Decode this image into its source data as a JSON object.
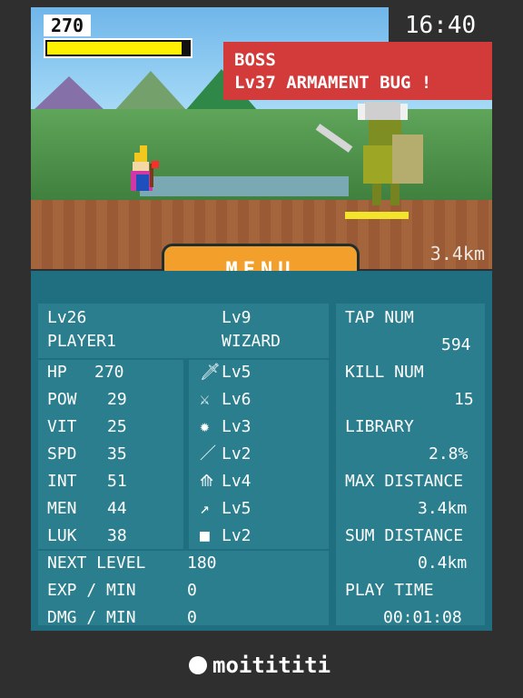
{
  "hud": {
    "player_hp": "270",
    "time": "16:40",
    "boss_title": "BOSS",
    "boss_name": "Lv37 ARMAMENT BUG !",
    "distance": "3.4km"
  },
  "menu": {
    "label": "MENU"
  },
  "player": {
    "level": "Lv26",
    "name": "PLAYER1",
    "class_level": "Lv9",
    "class_name": "WIZARD"
  },
  "stats": [
    {
      "label": "HP",
      "value": "270",
      "equip_icon": "sword-icon",
      "equip_level": "Lv5"
    },
    {
      "label": "POW",
      "value": "29",
      "equip_icon": "axe-icon",
      "equip_level": "Lv6"
    },
    {
      "label": "VIT",
      "value": "25",
      "equip_icon": "shield-icon",
      "equip_level": "Lv3"
    },
    {
      "label": "SPD",
      "value": "35",
      "equip_icon": "spear-icon",
      "equip_level": "Lv2"
    },
    {
      "label": "INT",
      "value": "51",
      "equip_icon": "bow-icon",
      "equip_level": "Lv4"
    },
    {
      "label": "MEN",
      "value": "44",
      "equip_icon": "arrow-icon",
      "equip_level": "Lv5"
    },
    {
      "label": "LUK",
      "value": "38",
      "equip_icon": "dice-icon",
      "equip_level": "Lv2"
    }
  ],
  "summary": [
    {
      "label": "NEXT LEVEL",
      "value": "180"
    },
    {
      "label": "EXP / MIN",
      "value": "0"
    },
    {
      "label": "DMG / MIN",
      "value": "0"
    }
  ],
  "right_stats": [
    {
      "label": "TAP NUM",
      "value": "594"
    },
    {
      "label": "KILL NUM",
      "value": "15"
    },
    {
      "label": "LIBRARY",
      "value": "2.8%"
    },
    {
      "label": "MAX DISTANCE",
      "value": "3.4km"
    },
    {
      "label": "SUM DISTANCE",
      "value": "0.4km"
    },
    {
      "label": "PLAY TIME",
      "value": "00:01:08"
    }
  ],
  "footer": {
    "brand": "moitititi"
  },
  "colors": {
    "hp_bar": "#ffef00",
    "boss_banner": "#d33b3b",
    "menu_button": "#f29f2b",
    "stats_bg": "#1f6f80",
    "panel_bg": "#2a7e8e"
  },
  "levels": {
    "player_hp_fill_fraction": 0.95,
    "boss_hp_fill_fraction": 1.0
  }
}
